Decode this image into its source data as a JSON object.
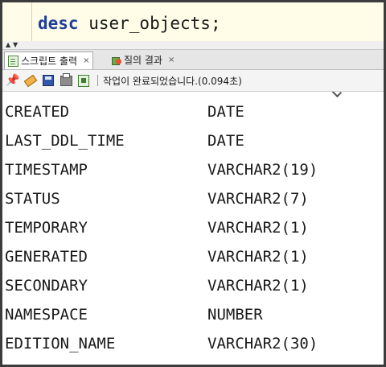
{
  "editor": {
    "keyword": "desc",
    "rest": " user_objects;"
  },
  "tabs": [
    {
      "label": "스크립트 출력",
      "close": "×",
      "icon": "script-output-icon"
    },
    {
      "label": "질의 결과",
      "close": "×",
      "icon": "query-result-icon"
    }
  ],
  "toolbar": {
    "icons": [
      "pin-icon",
      "eraser-icon",
      "save-icon",
      "print-icon",
      "export-icon"
    ],
    "status": "작업이 완료되었습니다.(0.094초)"
  },
  "output": {
    "rows": [
      {
        "name": "CREATED",
        "type": "DATE"
      },
      {
        "name": "LAST_DDL_TIME",
        "type": "DATE"
      },
      {
        "name": "TIMESTAMP",
        "type": "VARCHAR2(19)"
      },
      {
        "name": "STATUS",
        "type": "VARCHAR2(7)"
      },
      {
        "name": "TEMPORARY",
        "type": "VARCHAR2(1)"
      },
      {
        "name": "GENERATED",
        "type": "VARCHAR2(1)"
      },
      {
        "name": "SECONDARY",
        "type": "VARCHAR2(1)"
      },
      {
        "name": "NAMESPACE",
        "type": "NUMBER"
      },
      {
        "name": "EDITION_NAME",
        "type": "VARCHAR2(30)"
      }
    ]
  }
}
